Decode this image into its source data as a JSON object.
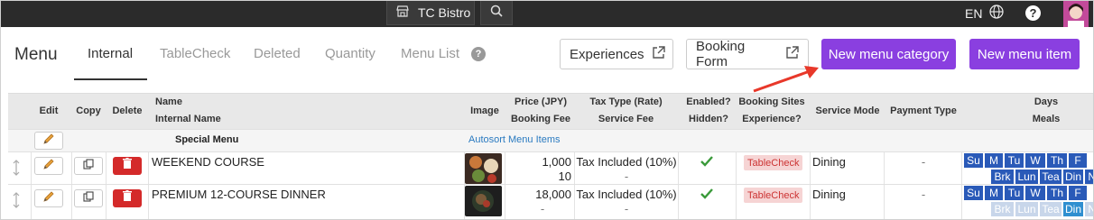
{
  "topbar": {
    "store_name": "TC Bistro",
    "language": "EN"
  },
  "header": {
    "title": "Menu",
    "tabs": [
      {
        "label": "Internal",
        "active": true
      },
      {
        "label": "TableCheck",
        "active": false
      },
      {
        "label": "Deleted",
        "active": false
      },
      {
        "label": "Quantity",
        "active": false
      },
      {
        "label": "Menu List",
        "active": false
      }
    ],
    "buttons": {
      "experiences": "Experiences",
      "booking_form": "Booking Form",
      "new_category": "New menu category",
      "new_item": "New menu item"
    }
  },
  "table": {
    "headers": {
      "edit": "Edit",
      "copy": "Copy",
      "delete": "Delete",
      "name": "Name",
      "internal_name": "Internal Name",
      "image": "Image",
      "price": "Price (JPY)",
      "booking_fee": "Booking Fee",
      "tax_type": "Tax Type (Rate)",
      "service_fee": "Service Fee",
      "enabled": "Enabled?",
      "hidden": "Hidden?",
      "booking_sites": "Booking Sites",
      "experience": "Experience?",
      "service_mode": "Service Mode",
      "payment_type": "Payment Type",
      "days": "Days",
      "meals": "Meals"
    },
    "category_row": {
      "name": "Special Menu",
      "autosort": "Autosort Menu Items"
    },
    "rows": [
      {
        "name": "WEEKEND COURSE",
        "price": "1,000",
        "booking_fee": "10",
        "tax_type": "Tax Included (10%)",
        "service_fee": "-",
        "booking_site": "TableCheck",
        "service_mode": "Dining",
        "payment_type": "-",
        "days": [
          "Su",
          "M",
          "Tu",
          "W",
          "Th",
          "F"
        ],
        "meals": [
          "Brk",
          "Lun",
          "Tea",
          "Din",
          "Ni"
        ]
      },
      {
        "name": "PREMIUM 12-COURSE DINNER",
        "price": "18,000",
        "booking_fee": "-",
        "tax_type": "Tax Included (10%)",
        "service_fee": "-",
        "booking_site": "TableCheck",
        "service_mode": "Dining",
        "payment_type": "-",
        "days": [
          "Su",
          "M",
          "Tu",
          "W",
          "Th",
          "F"
        ],
        "meals": [
          "Brk",
          "Lun",
          "Tea",
          "Din",
          "Ni"
        ]
      }
    ]
  },
  "colors": {
    "accent_purple": "#8a3fe0",
    "topbar": "#2b2b2b",
    "day_blue": "#2a5ab8",
    "meal_blue": "#2f8fd0",
    "delete_red": "#d42a2a",
    "annotation_arrow": "#e8382a"
  }
}
